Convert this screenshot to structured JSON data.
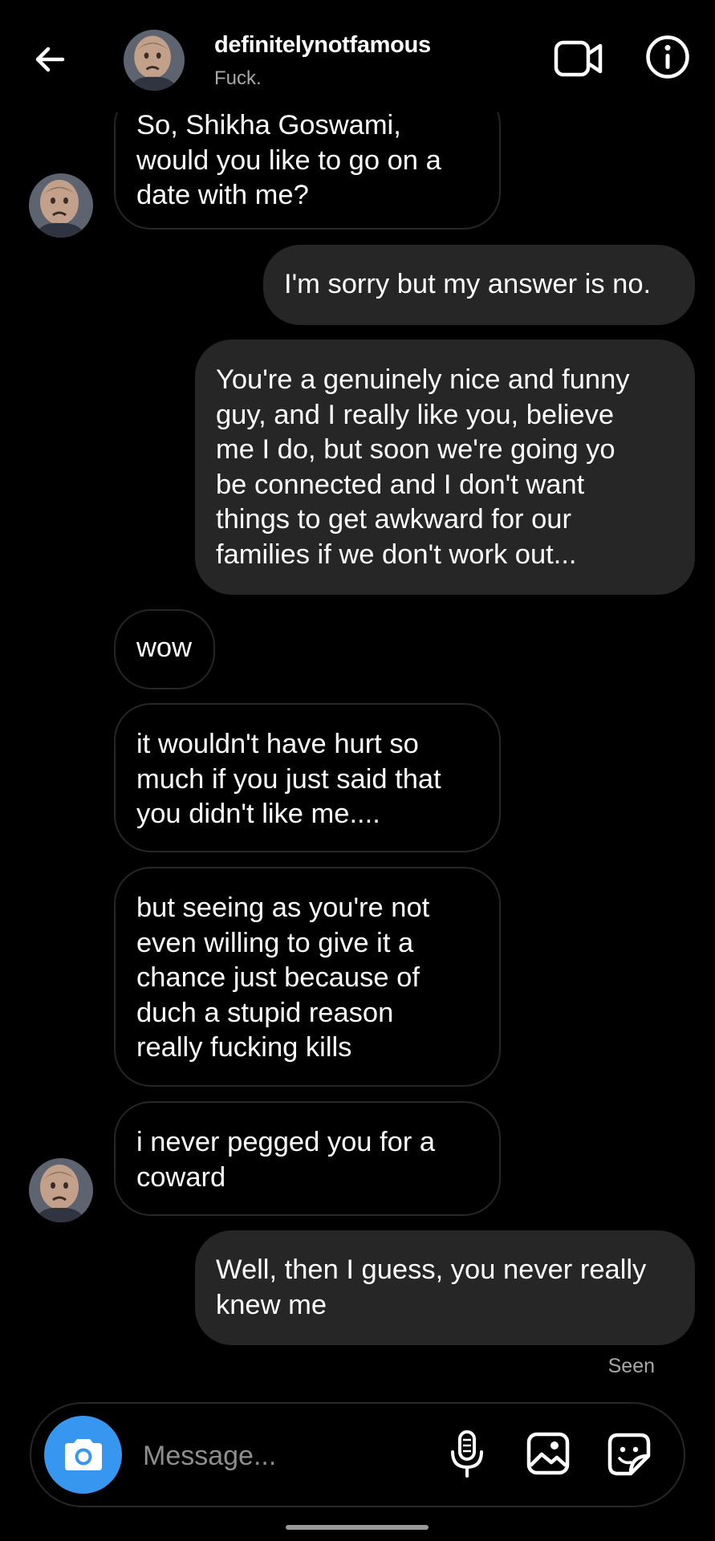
{
  "header": {
    "username": "definitelynotfamous",
    "status": "Fuck.",
    "icons": {
      "back": "arrow-left-icon",
      "video": "video-camera-icon",
      "info": "info-icon"
    }
  },
  "messages": [
    {
      "direction": "in",
      "lines": [
        "So, Shikha Goswami,",
        "would you like to go on a",
        "date with me?"
      ]
    },
    {
      "direction": "out",
      "lines": [
        "I'm sorry but my answer is no."
      ]
    },
    {
      "direction": "out",
      "lines": [
        "You're a genuinely nice and funny",
        "guy, and I really like you, believe",
        "me I do, but soon we're going yo",
        "be connected and I don't want",
        "things to get awkward for our",
        "families if we don't work out..."
      ]
    },
    {
      "direction": "in",
      "lines": [
        "wow"
      ]
    },
    {
      "direction": "in",
      "lines": [
        "it wouldn't have hurt so",
        "much if you just said that",
        "you didn't like me...."
      ]
    },
    {
      "direction": "in",
      "lines": [
        "but seeing as you're not",
        "even willing to give it a",
        "chance just because of",
        "duch a stupid reason",
        "really fucking kills"
      ]
    },
    {
      "direction": "in",
      "lines": [
        "i never pegged you for a",
        "coward"
      ]
    },
    {
      "direction": "out",
      "lines": [
        "Well, then I guess, you never really",
        "knew me"
      ]
    }
  ],
  "seen_label": "Seen",
  "composer": {
    "placeholder": "Message...",
    "icons": {
      "camera": "camera-icon",
      "mic": "microphone-icon",
      "gallery": "image-icon",
      "sticker": "sticker-icon"
    }
  },
  "colors": {
    "background": "#000000",
    "outgoing_bubble": "#262626",
    "incoming_border": "#262626",
    "secondary_text": "#a8a8a8",
    "camera_button": "#3797f0"
  }
}
